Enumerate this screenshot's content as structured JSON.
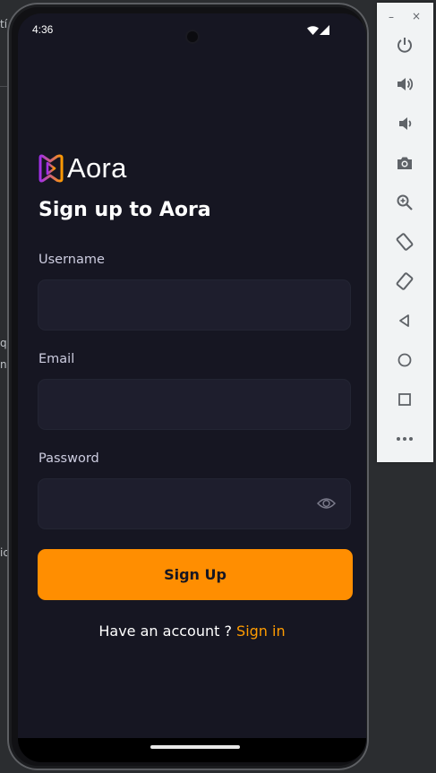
{
  "background_ide": {
    "fragments": [
      "tí",
      "q",
      "nt",
      "ic"
    ]
  },
  "status_bar": {
    "time": "4:36"
  },
  "app": {
    "logo_text": "Aora",
    "title": "Sign up to Aora",
    "fields": {
      "username": {
        "label": "Username",
        "value": ""
      },
      "email": {
        "label": "Email",
        "value": ""
      },
      "password": {
        "label": "Password",
        "value": ""
      }
    },
    "submit_label": "Sign Up",
    "footer_text": "Have an account ? ",
    "footer_link": "Sign in"
  },
  "emulator_toolbar": {
    "minimize": "–",
    "close": "×",
    "buttons": [
      "power-icon",
      "volume-up-icon",
      "volume-down-icon",
      "camera-icon",
      "zoom-icon",
      "rotate-left-icon",
      "rotate-right-icon",
      "back-icon",
      "home-icon",
      "overview-icon",
      "more-icon"
    ]
  },
  "colors": {
    "screen_bg": "#161622",
    "field_bg": "#1e1e2d",
    "accent": "#ff8e01",
    "link": "#ff9c01"
  }
}
